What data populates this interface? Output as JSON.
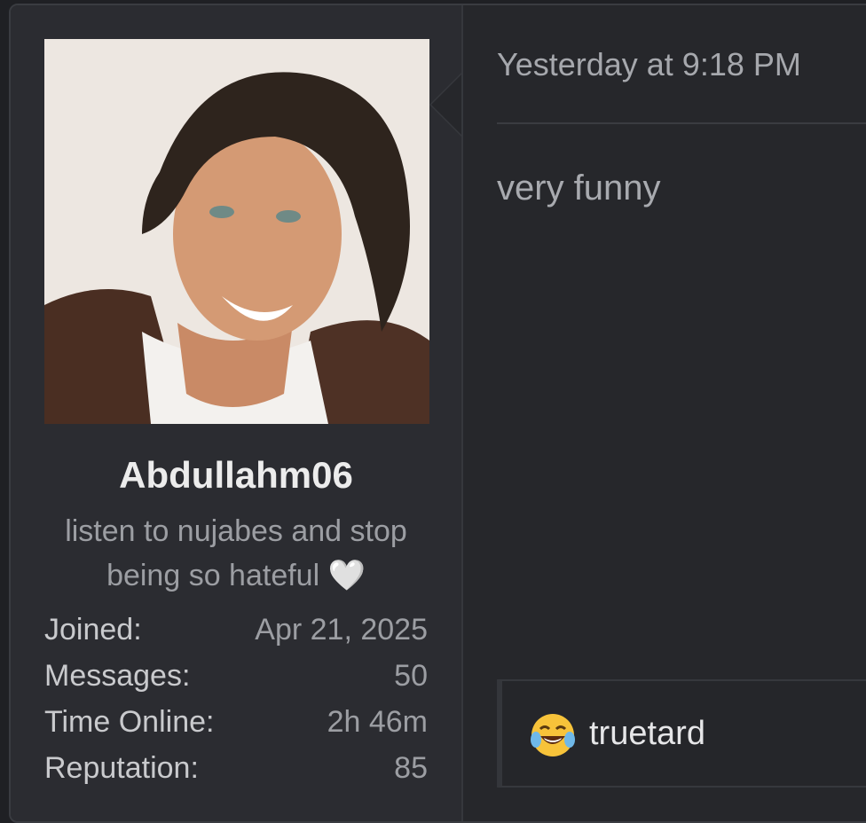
{
  "user": {
    "username": "Abdullahm06",
    "status_line1": "listen to nujabes and stop",
    "status_line2": "being so hateful 🤍",
    "stats": [
      {
        "label": "Joined:",
        "value": "Apr 21, 2025"
      },
      {
        "label": "Messages:",
        "value": "50"
      },
      {
        "label": "Time Online:",
        "value": "2h 46m"
      },
      {
        "label": "Reputation:",
        "value": "85"
      }
    ]
  },
  "post": {
    "timestamp": "Yesterday at 9:18 PM",
    "message": "very funny"
  },
  "reactions": {
    "emoji_icon": "laughing-tears-emoji-icon",
    "user": "truetard"
  },
  "colors": {
    "background": "#26272b",
    "sidebar": "#2b2c31",
    "text_primary": "#ececec",
    "text_muted": "#9c9ea3"
  }
}
